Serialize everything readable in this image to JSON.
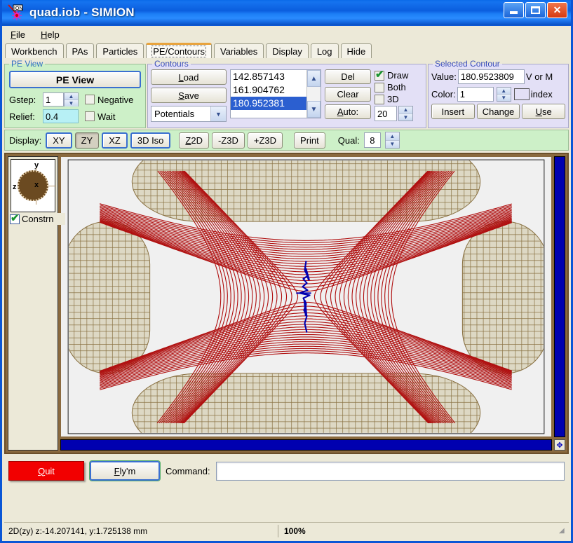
{
  "window": {
    "title": "quad.iob - SIMION",
    "icon": "ion-icon",
    "minimize_label": "Minimize",
    "maximize_label": "Maximize",
    "close_label": "✕"
  },
  "menubar": {
    "items": [
      {
        "label": "File",
        "accel": "F"
      },
      {
        "label": "Help",
        "accel": "H"
      }
    ]
  },
  "tabs": [
    {
      "label": "Workbench",
      "active": false
    },
    {
      "label": "PAs",
      "active": false
    },
    {
      "label": "Particles",
      "active": false
    },
    {
      "label": "PE/Contours",
      "active": true
    },
    {
      "label": "Variables",
      "active": false
    },
    {
      "label": "Display",
      "active": false
    },
    {
      "label": "Log",
      "active": false
    },
    {
      "label": "Hide",
      "active": false
    }
  ],
  "pe_view": {
    "legend": "PE View",
    "button_label": "PE View",
    "gstep_label": "Gstep:",
    "gstep_value": "1",
    "relief_label": "Relief:",
    "relief_value": "0.4",
    "negative_label": "Negative",
    "negative_checked": false,
    "wait_label": "Wait",
    "wait_checked": false
  },
  "contours": {
    "legend": "Contours",
    "load_label": "Load",
    "save_label": "Save",
    "mode_value": "Potentials",
    "list": [
      {
        "value": "142.857143",
        "selected": false
      },
      {
        "value": "161.904762",
        "selected": false
      },
      {
        "value": "180.952381",
        "selected": true
      }
    ],
    "del_label": "Del",
    "clear_label": "Clear",
    "auto_label": "Auto:",
    "auto_value": "20",
    "draw_label": "Draw",
    "draw_checked": true,
    "both_label": "Both",
    "both_checked": false,
    "threed_label": "3D",
    "threed_checked": false
  },
  "selected_contour": {
    "legend": "Selected Contour",
    "value_label": "Value:",
    "value": "180.9523809",
    "units": "V or M",
    "color_label": "Color:",
    "color_index": "1",
    "color_swatch": "#a81010",
    "index_label": "index",
    "insert_label": "Insert",
    "change_label": "Change",
    "use_label": "Use"
  },
  "display_bar": {
    "label": "Display:",
    "buttons": [
      {
        "label": "XY",
        "pressed": false,
        "highlight": true
      },
      {
        "label": "ZY",
        "pressed": true,
        "highlight": false
      },
      {
        "label": "XZ",
        "pressed": false,
        "highlight": true
      },
      {
        "label": "3D Iso",
        "pressed": false,
        "highlight": true
      },
      {
        "label": "Z2D",
        "pressed": false,
        "highlight": false
      },
      {
        "label": "-Z3D",
        "pressed": false,
        "highlight": false
      },
      {
        "label": "+Z3D",
        "pressed": false,
        "highlight": false
      },
      {
        "label": "Print",
        "pressed": false,
        "highlight": false
      }
    ],
    "qual_label": "Qual:",
    "qual_value": "8"
  },
  "viewport": {
    "compass_axes": {
      "y": "y",
      "z": "z",
      "x": "x"
    },
    "constrain_label": "Constrn",
    "constrain_checked": true
  },
  "chart_data": {
    "type": "contour",
    "title": "Quadrupole potential-energy contour map (ZY plane)",
    "contour_color": "#b01010",
    "trajectory_color": "#0000b0",
    "electrode_color": "#8a7243",
    "background": "#f0f0f0",
    "contour_count": 20,
    "contour_values_visible": [
      "142.857143",
      "161.904762",
      "180.952381"
    ],
    "selected_contour_value": 180.952381,
    "units": "V",
    "electrodes": [
      {
        "name": "top",
        "shape": "rounded-block",
        "mesh": true
      },
      {
        "name": "bottom",
        "shape": "rounded-block",
        "mesh": true
      },
      {
        "name": "left",
        "shape": "rounded-block",
        "mesh": true
      },
      {
        "name": "right",
        "shape": "rounded-block",
        "mesh": true
      }
    ],
    "saddle_point": {
      "z": 0,
      "y": 0,
      "description": "central saddle with ion trajectory"
    }
  },
  "command_bar": {
    "quit_label": "Quit",
    "flym_label": "Fly'm",
    "command_label": "Command:",
    "command_value": "",
    "command_placeholder": ""
  },
  "status_bar": {
    "coords": "2D(zy) z:-14.207141, y:1.725138 mm",
    "zoom": "100%"
  }
}
